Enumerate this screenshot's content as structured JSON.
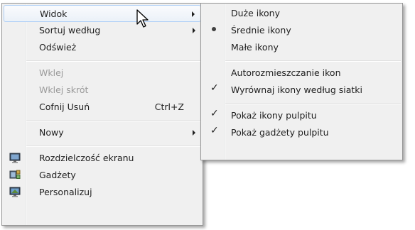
{
  "context_menu": {
    "view": "Widok",
    "sort_by": "Sortuj według",
    "refresh": "Odśwież",
    "paste": "Wklej",
    "paste_shortcut": "Wklej skrót",
    "undo_delete": "Cofnij Usuń",
    "undo_shortcut": "Ctrl+Z",
    "new": "Nowy",
    "screen_resolution": "Rozdzielczość ekranu",
    "gadgets": "Gadżety",
    "personalize": "Personalizuj"
  },
  "view_submenu": {
    "large_icons": "Duże ikony",
    "medium_icons": "Średnie ikony",
    "small_icons": "Małe ikony",
    "auto_arrange": "Autorozmieszczanie ikon",
    "align_to_grid": "Wyrównaj ikony według siatki",
    "show_desktop_icons": "Pokaż ikony pulpitu",
    "show_desktop_gadgets": "Pokaż gadżety pulpitu"
  },
  "state": {
    "selected_icon_size": "medium_icons",
    "align_to_grid_checked": true,
    "show_desktop_icons_checked": true,
    "show_desktop_gadgets_checked": true
  },
  "icons": {
    "check": "✓",
    "submenu_arrow": "chevron-right-icon"
  },
  "colors": {
    "menu_background": "#f0f0f0",
    "menu_border": "#979797",
    "hover_border": "#aecff7",
    "disabled_text": "#9a9a9a"
  }
}
